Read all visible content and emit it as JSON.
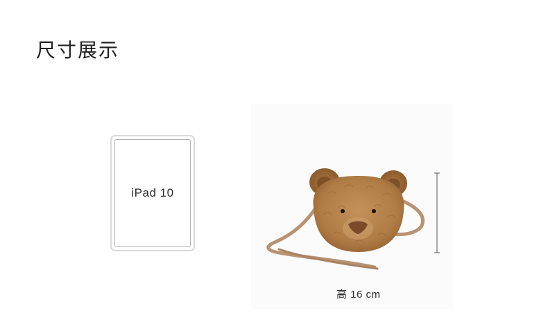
{
  "page": {
    "title": "尺寸展示"
  },
  "reference_device": {
    "label": "iPad 10"
  },
  "product": {
    "height_label": "高 16 cm",
    "colors": {
      "fur": "#b07c45",
      "fur_dark": "#8a5a2c",
      "nose": "#7a4a2a",
      "strap": "#b89272"
    }
  }
}
